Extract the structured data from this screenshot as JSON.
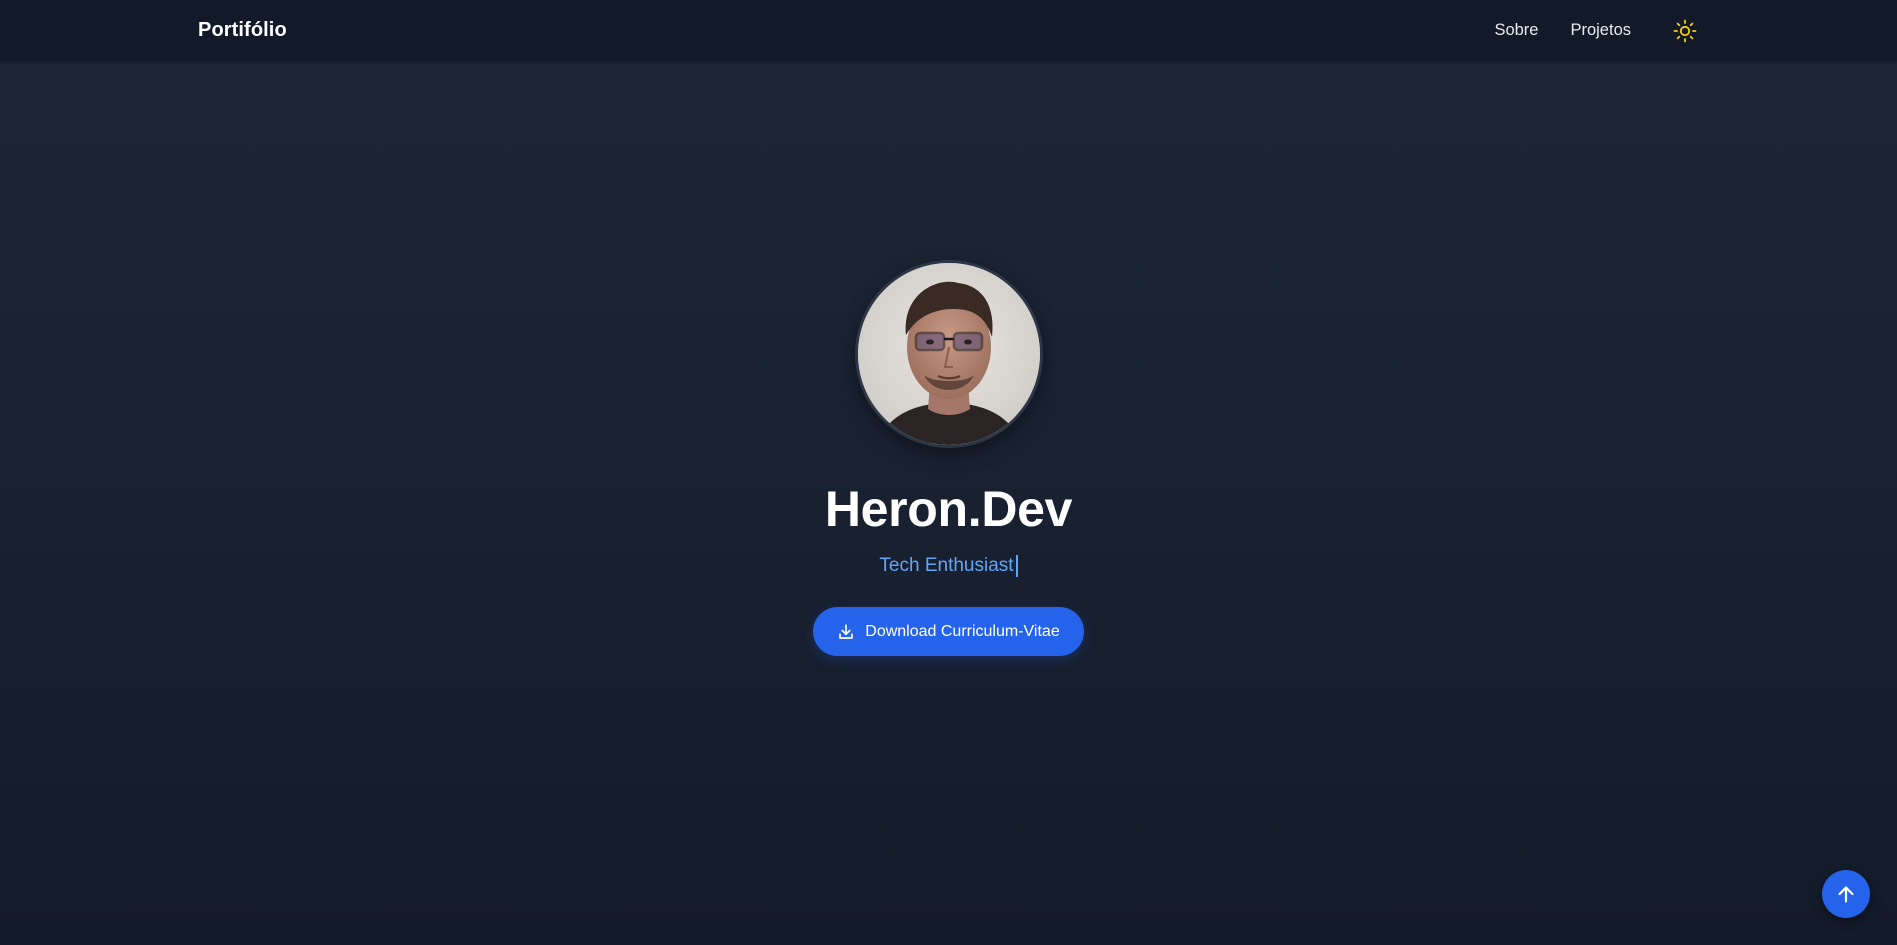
{
  "navbar": {
    "brand": "Portifólio",
    "links": [
      {
        "label": "Sobre"
      },
      {
        "label": "Projetos"
      }
    ],
    "theme_toggle_icon": "sun-icon"
  },
  "hero": {
    "avatar_alt": "profile-photo",
    "name": "Heron.Dev",
    "tagline": "Tech Enthusiast",
    "cv_button": {
      "label": "Download Curriculum-Vitae",
      "icon": "download-icon"
    }
  },
  "back_to_top": {
    "icon": "arrow-up-icon"
  },
  "colors": {
    "accent": "#2563eb",
    "tagline": "#60a5fa",
    "sun": "#facc15",
    "background": "#1b2332",
    "navbar": "#121a29"
  }
}
